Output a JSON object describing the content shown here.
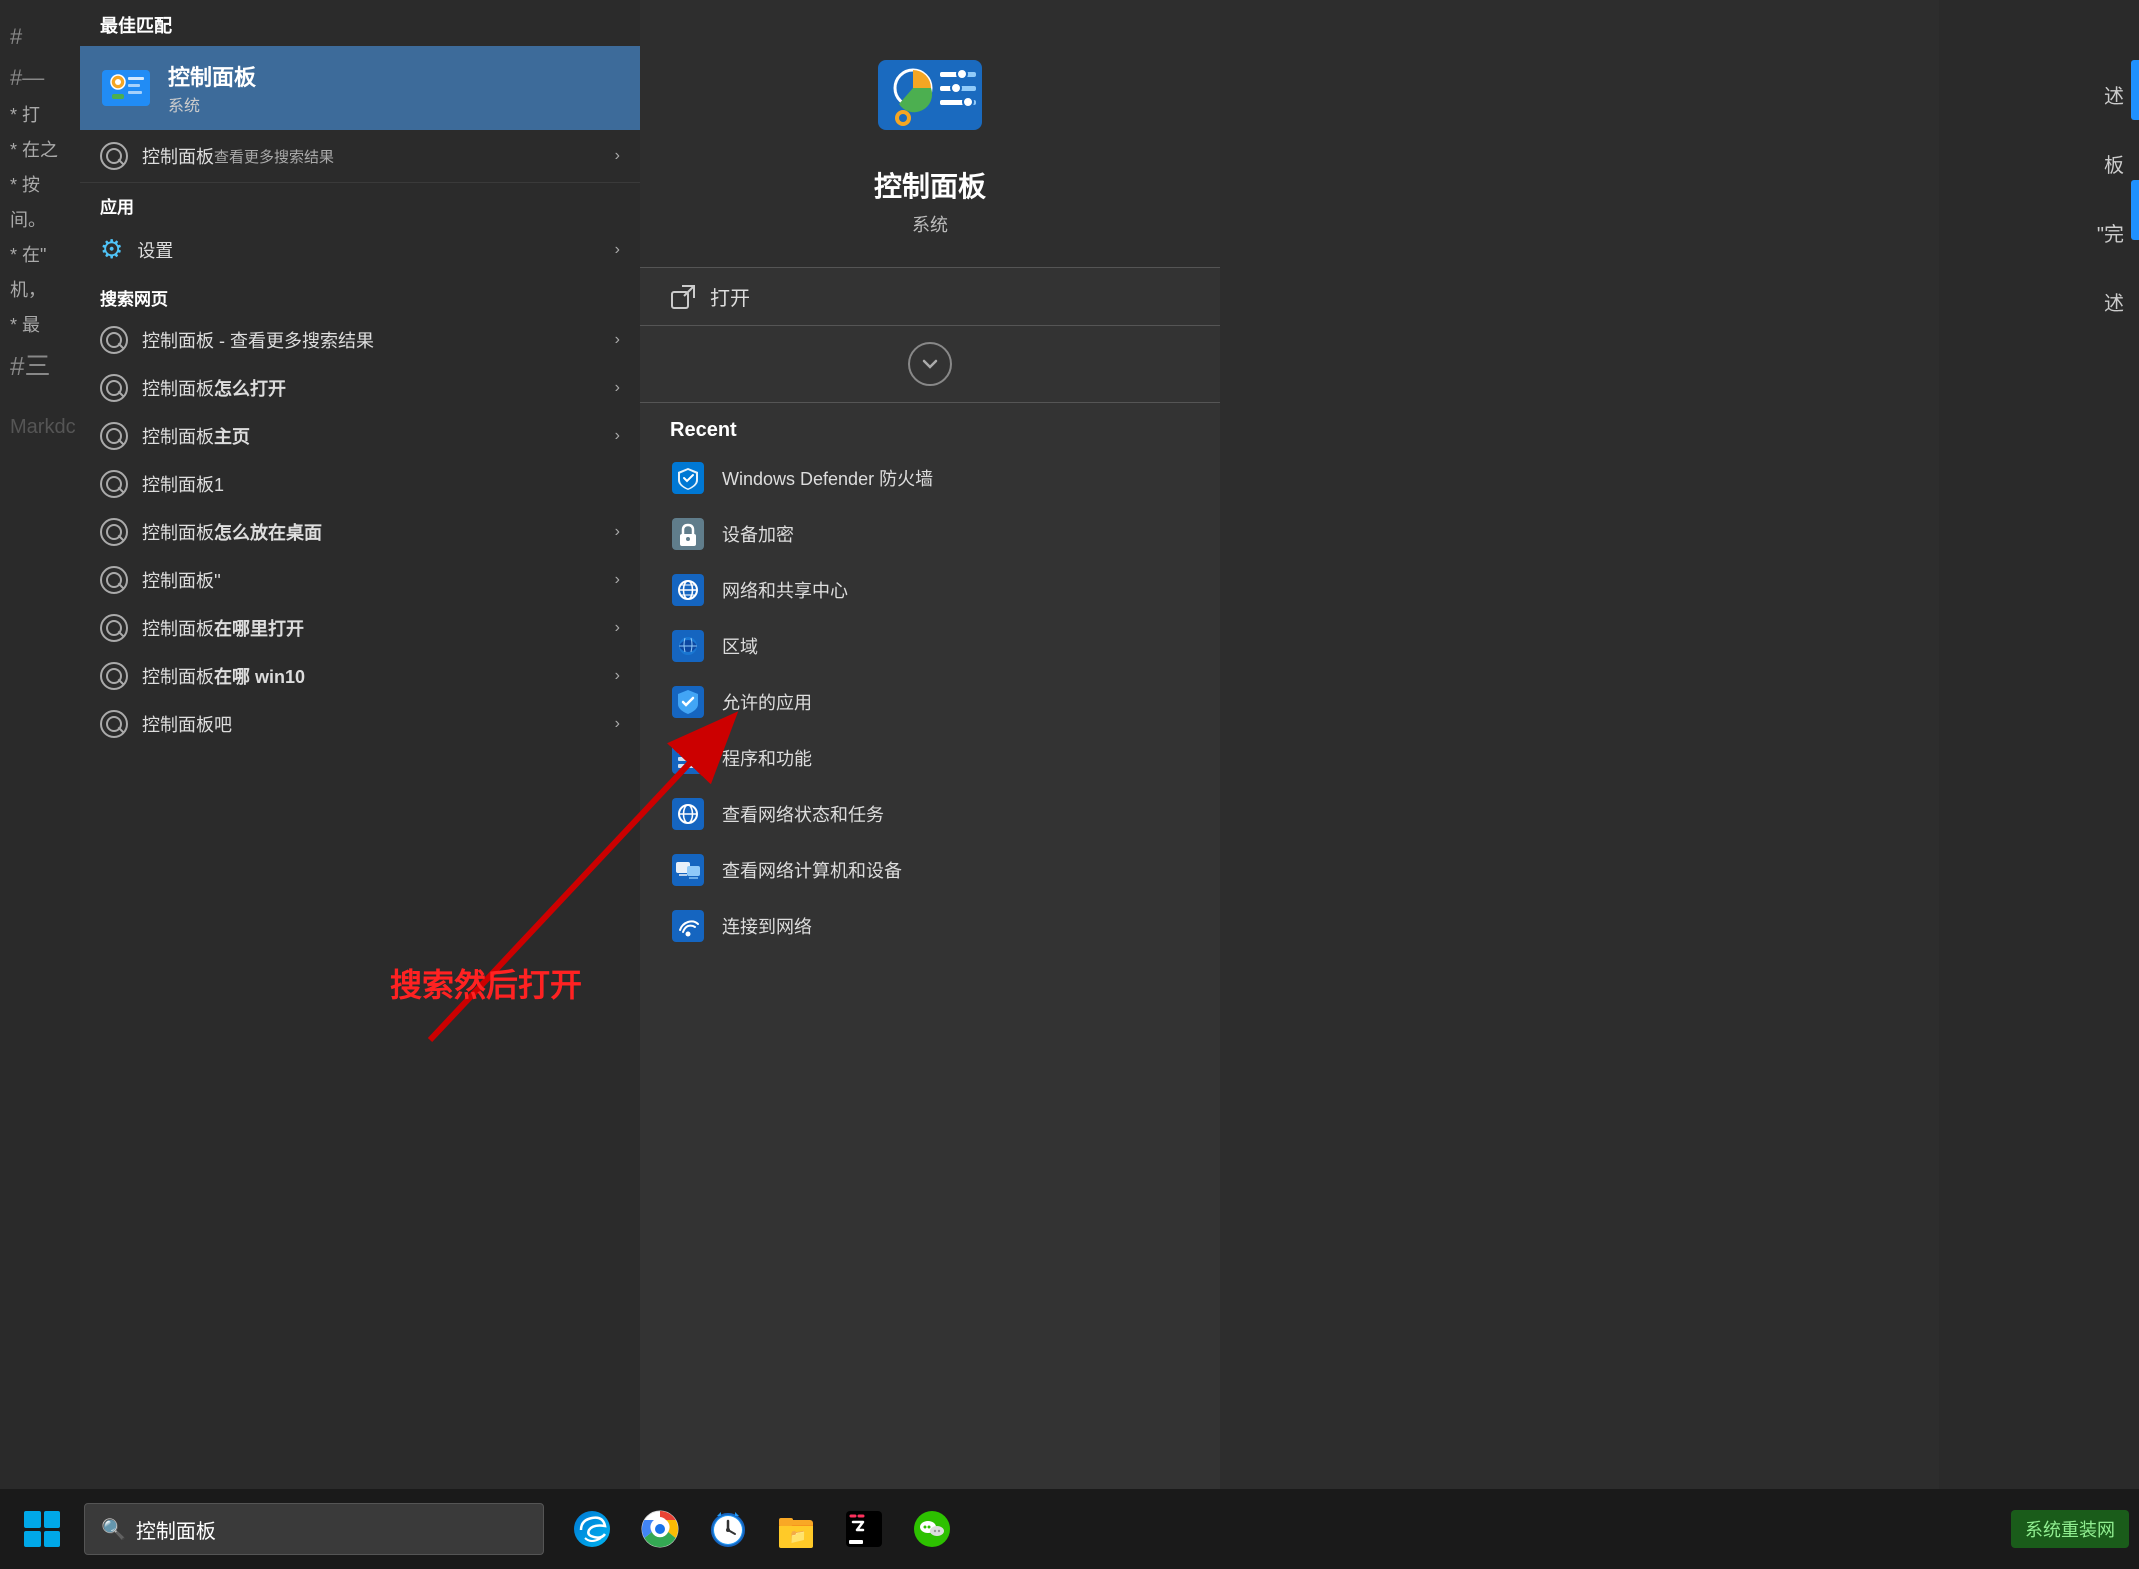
{
  "background": {
    "color": "#2d2d2d"
  },
  "document": {
    "left_lines": [
      "#",
      "#",
      "* 打印",
      "* 在之",
      "* 按照",
      "间。",
      "* 在\"",
      "机，",
      "* 最后"
    ],
    "right_lines": [
      "述",
      "板",
      "完",
      "述"
    ]
  },
  "search_panel": {
    "best_match_header": "最佳匹配",
    "best_match": {
      "title": "控制面板",
      "subtitle": "系统"
    },
    "see_more_label": "控制面板",
    "see_more_sub": "查看更多搜索结果",
    "sections": [
      {
        "header": "应用",
        "items": [
          {
            "label": "设置",
            "has_arrow": true
          }
        ]
      },
      {
        "header": "搜索网页",
        "items": [
          {
            "label": "控制面板 - 查看更多搜索结果",
            "has_arrow": true
          },
          {
            "label_parts": [
              "控制面板",
              "怎么打开"
            ],
            "has_arrow": true
          },
          {
            "label_parts": [
              "控制面板",
              "主页"
            ],
            "has_arrow": true
          },
          {
            "label": "控制面板1",
            "has_arrow": false
          },
          {
            "label_parts": [
              "控制面板",
              "怎么放在桌面"
            ],
            "has_arrow": true
          },
          {
            "label": "控制面板''",
            "has_arrow": true
          },
          {
            "label_parts": [
              "控制面板",
              "在哪里打开"
            ],
            "has_arrow": true
          },
          {
            "label_parts": [
              "控制面板",
              "在哪 win10"
            ],
            "has_arrow": true
          },
          {
            "label": "控制面板吧",
            "has_arrow": true
          }
        ]
      }
    ]
  },
  "detail_panel": {
    "title": "控制面板",
    "subtitle": "系统",
    "open_label": "打开",
    "recent_header": "Recent",
    "recent_items": [
      {
        "label": "Windows Defender 防火墙"
      },
      {
        "label": "设备加密"
      },
      {
        "label": "网络和共享中心"
      },
      {
        "label": "区域"
      },
      {
        "label": "允许的应用"
      },
      {
        "label": "程序和功能"
      },
      {
        "label": "查看网络状态和任务"
      },
      {
        "label": "查看网络计算机和设备"
      },
      {
        "label": "连接到网络"
      }
    ]
  },
  "annotation": {
    "text": "搜索然后打开"
  },
  "taskbar": {
    "search_value": "控制面板",
    "search_placeholder": "控制面板",
    "tray_label": "系统重装网"
  }
}
